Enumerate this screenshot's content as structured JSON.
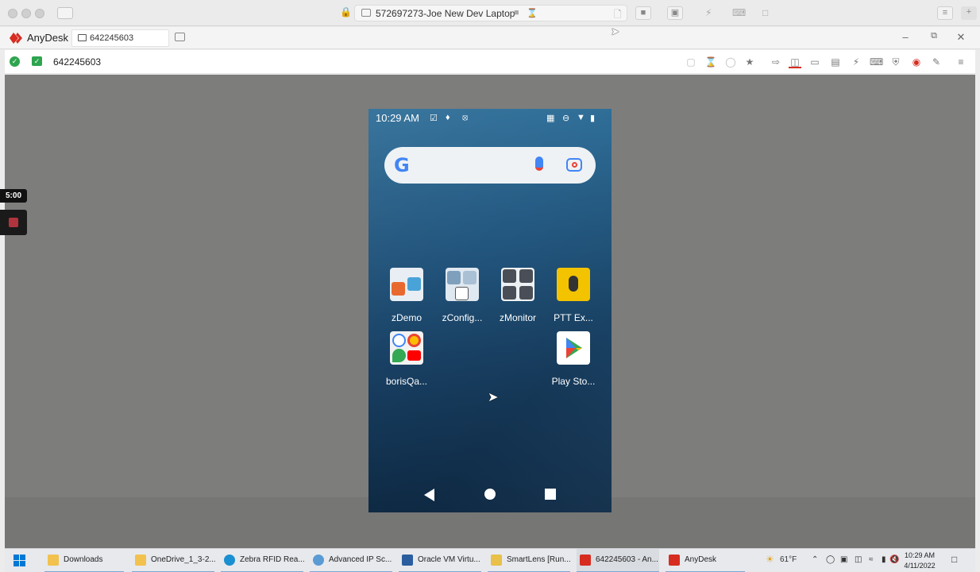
{
  "mac_window": {
    "title": "572697273-Joe New Dev Laptop"
  },
  "anydesk": {
    "brand": "AnyDesk",
    "tab_label": "642245603",
    "address": "642245603",
    "brand_color": "#d62d20"
  },
  "phone": {
    "status_time": "10:29 AM",
    "search_logo": "G",
    "apps": [
      {
        "label": "zDemo"
      },
      {
        "label": "zConfig..."
      },
      {
        "label": "zMonitor"
      },
      {
        "label": "PTT Ex..."
      },
      {
        "label": "borisQa..."
      },
      {
        "label": "Play Sto..."
      }
    ]
  },
  "recorder": {
    "timer": "5:00"
  },
  "taskbar": {
    "items": [
      {
        "label": "Downloads",
        "color": "#f2c14e"
      },
      {
        "label": "OneDrive_1_3-2...",
        "color": "#f2c14e"
      },
      {
        "label": "Zebra RFID Rea...",
        "color": "#1a8fd1"
      },
      {
        "label": "Advanced IP Sc...",
        "color": "#5a9bd4"
      },
      {
        "label": "Oracle VM Virtu...",
        "color": "#2b5e9e"
      },
      {
        "label": "SmartLens [Run...",
        "color": "#e8c04a"
      },
      {
        "label": "642245603 - An...",
        "color": "#d62d20"
      },
      {
        "label": "AnyDesk",
        "color": "#d62d20"
      }
    ],
    "weather": "61°F",
    "clock_time": "10:29 AM",
    "clock_date": "4/11/2022"
  }
}
